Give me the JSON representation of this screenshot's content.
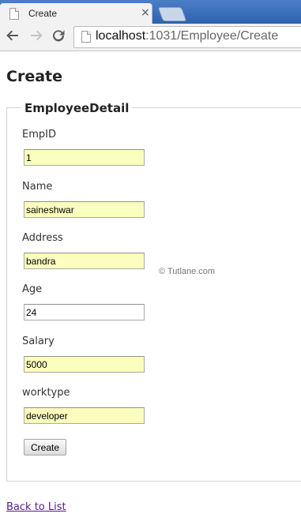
{
  "browser": {
    "tab_title": "Create",
    "tab_close_symbol": "×",
    "url_host": "localhost",
    "url_path": ":1031/Employee/Create",
    "icons": {
      "tab": "page-icon",
      "close": "close-icon",
      "back": "back-arrow-icon",
      "forward": "forward-arrow-icon",
      "reload": "reload-icon",
      "omnibox": "page-icon"
    },
    "colors": {
      "tabbar": "#3c6fb6",
      "toolbar": "#f2f2f2"
    }
  },
  "page": {
    "title": "Create",
    "legend": "EmployeeDetail",
    "fields": {
      "empid": {
        "label": "EmpID",
        "value": "1",
        "autofill": true
      },
      "name": {
        "label": "Name",
        "value": "saineshwar",
        "autofill": true
      },
      "address": {
        "label": "Address",
        "value": "bandra",
        "autofill": true
      },
      "age": {
        "label": "Age",
        "value": "24",
        "autofill": false
      },
      "salary": {
        "label": "Salary",
        "value": "5000",
        "autofill": true
      },
      "worktype": {
        "label": "worktype",
        "value": "developer",
        "autofill": true
      }
    },
    "submit_label": "Create",
    "watermark": "© Tutlane.com",
    "back_link": "Back to List",
    "colors": {
      "autofill_bg": "#faffbd",
      "link": "#551a8b"
    }
  }
}
